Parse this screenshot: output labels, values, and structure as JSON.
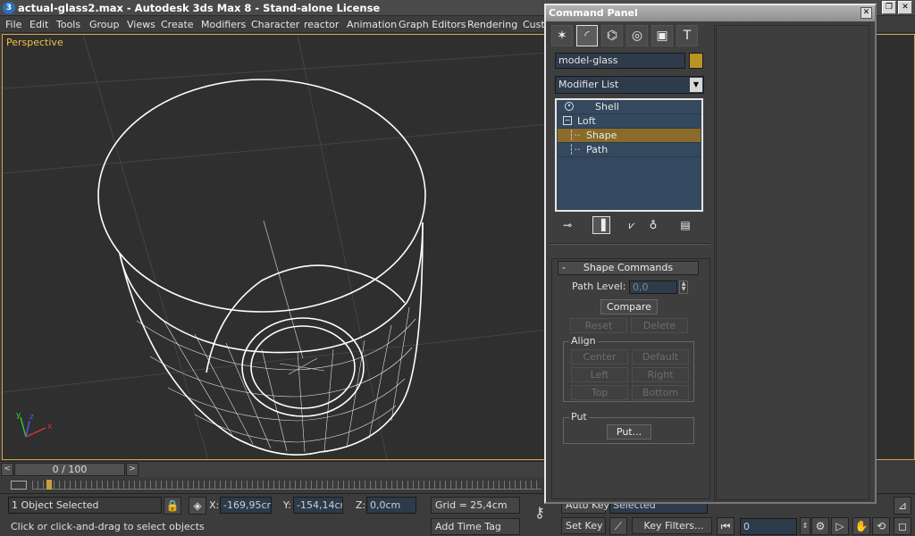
{
  "window": {
    "title": "actual-glass2.max - Autodesk 3ds Max 8  - Stand-alone License",
    "app_icon": "3"
  },
  "menu": [
    "File",
    "Edit",
    "Tools",
    "Group",
    "Views",
    "Create",
    "Modifiers",
    "Character",
    "reactor",
    "Animation",
    "Graph Editors",
    "Rendering",
    "Cust"
  ],
  "viewport": {
    "label": "Perspective",
    "axis": {
      "x": "x",
      "y": "y",
      "z": "z"
    }
  },
  "timeline": {
    "frame": "0 / 100",
    "prev": "<",
    "next": ">"
  },
  "status": {
    "selection": "1 Object Selected",
    "prompt": "Click or click-and-drag to select objects",
    "x_label": "X:",
    "x_value": "-169,95cm",
    "y_label": "Y:",
    "y_value": "-154,14cm",
    "z_label": "Z:",
    "z_value": "0,0cm",
    "grid": "Grid = 25,4cm",
    "add_time_tag": "Add Time Tag",
    "auto_key": "Auto Key",
    "auto_key_mode": "Selected",
    "set_key": "Set Key",
    "key_filters": "Key Filters...",
    "current_frame": "0"
  },
  "command_panel": {
    "title": "Command Panel",
    "object_name": "model-glass",
    "object_color": "#b89424",
    "modifier_list": "Modifier List",
    "stack": [
      {
        "label": "Shell",
        "indent": 0
      },
      {
        "label": "Loft",
        "indent": 0
      },
      {
        "label": "Shape",
        "indent": 1,
        "selected": true
      },
      {
        "label": "Path",
        "indent": 1
      }
    ],
    "rollout": {
      "title": "Shape Commands",
      "collapse": "-",
      "path_level_label": "Path Level:",
      "path_level_value": "0,0",
      "compare": "Compare",
      "reset": "Reset",
      "delete": "Delete",
      "align_group": "Align",
      "center": "Center",
      "default": "Default",
      "left": "Left",
      "right": "Right",
      "top": "Top",
      "bottom": "Bottom",
      "put_group": "Put",
      "put": "Put..."
    }
  }
}
